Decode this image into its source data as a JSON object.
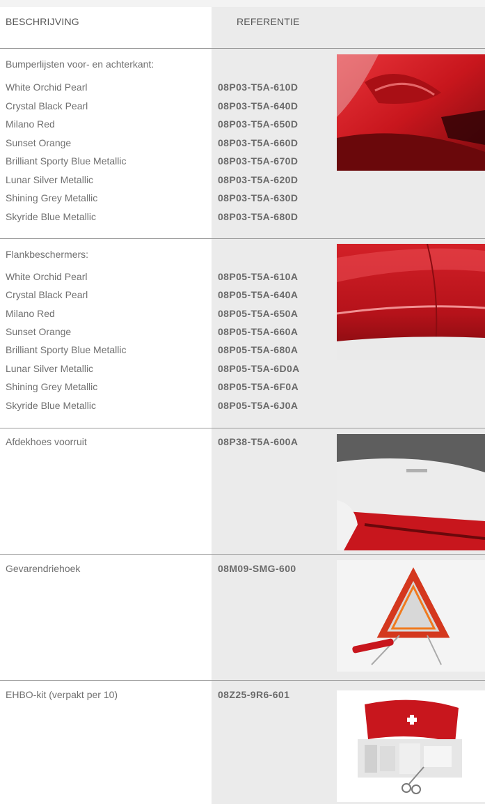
{
  "header": {
    "description": "BESCHRIJVING",
    "reference": "REFERENTIE"
  },
  "sections": [
    {
      "title": "Bumperlijsten voor- en achterkant:",
      "image": "bumper-strip-photo",
      "items": [
        {
          "label": "White Orchid Pearl",
          "ref": "08P03-T5A-610D"
        },
        {
          "label": "Crystal Black Pearl",
          "ref": "08P03-T5A-640D"
        },
        {
          "label": "Milano Red",
          "ref": "08P03-T5A-650D"
        },
        {
          "label": "Sunset Orange",
          "ref": "08P03-T5A-660D"
        },
        {
          "label": "Brilliant Sporty Blue Metallic",
          "ref": "08P03-T5A-670D"
        },
        {
          "label": "Lunar Silver Metallic",
          "ref": "08P03-T5A-620D"
        },
        {
          "label": "Shining Grey Metallic",
          "ref": "08P03-T5A-630D"
        },
        {
          "label": "Skyride Blue Metallic",
          "ref": "08P03-T5A-680D"
        }
      ]
    },
    {
      "title": "Flankbeschermers:",
      "image": "side-protector-photo",
      "items": [
        {
          "label": "White Orchid Pearl",
          "ref": "08P05-T5A-610A"
        },
        {
          "label": "Crystal Black Pearl",
          "ref": "08P05-T5A-640A"
        },
        {
          "label": "Milano Red",
          "ref": "08P05-T5A-650A"
        },
        {
          "label": "Sunset Orange",
          "ref": "08P05-T5A-660A"
        },
        {
          "label": "Brilliant Sporty Blue Metallic",
          "ref": "08P05-T5A-680A"
        },
        {
          "label": "Lunar Silver Metallic",
          "ref": "08P05-T5A-6D0A"
        },
        {
          "label": "Shining Grey Metallic",
          "ref": "08P05-T5A-6F0A"
        },
        {
          "label": "Skyride Blue Metallic",
          "ref": "08P05-T5A-6J0A"
        }
      ]
    },
    {
      "title": "Afdekhoes voorruit",
      "ref": "08P38-T5A-600A",
      "image": "windscreen-cover-photo"
    },
    {
      "title": "Gevarendriehoek",
      "ref": "08M09-SMG-600",
      "image": "warning-triangle-photo"
    },
    {
      "title": "EHBO-kit (verpakt per 10)",
      "ref": "08Z25-9R6-601",
      "image": "first-aid-kit-photo"
    }
  ],
  "colors": {
    "reference_column_bg": "#ebebeb",
    "rule": "#9a9a9a",
    "text": "#707070",
    "car_red": "#c8161d"
  }
}
